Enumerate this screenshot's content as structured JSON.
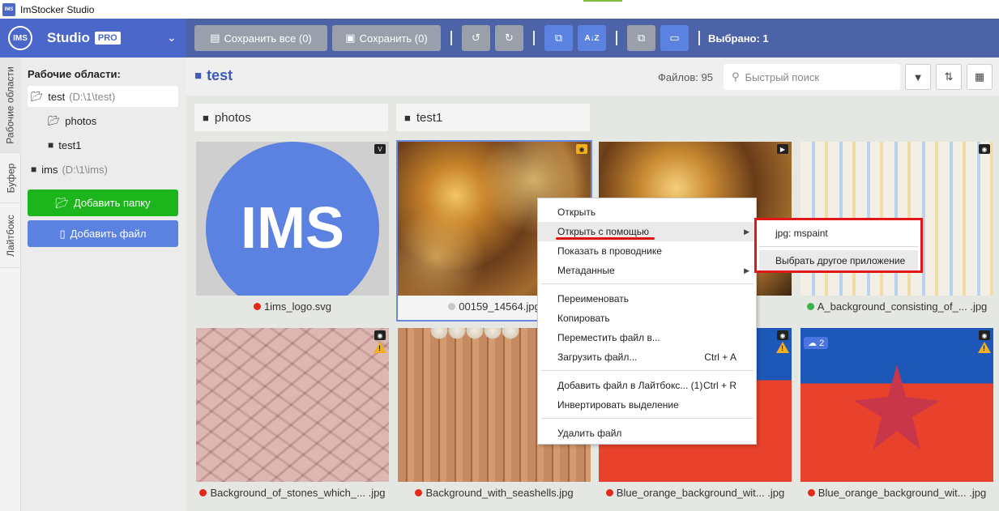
{
  "window": {
    "title": "ImStocker Studio"
  },
  "brand": {
    "logo": "IMS",
    "name": "Studio",
    "badge": "PRO"
  },
  "toolbar": {
    "save_all": "Сохранить все (0)",
    "save": "Сохранить (0)",
    "selected": "Выбрано: 1"
  },
  "vtabs": [
    "Рабочие области",
    "Буфер",
    "Лайтбокс"
  ],
  "sidebar": {
    "heading": "Рабочие области:",
    "tree": [
      {
        "label": "test",
        "path": "(D:\\1\\test)"
      },
      {
        "label": "photos"
      },
      {
        "label": "test1"
      },
      {
        "label": "ims",
        "path": "(D:\\1\\ims)"
      }
    ],
    "add_folder": "Добавить папку",
    "add_file": "Добавить файл"
  },
  "main": {
    "folder": "test",
    "files_count": "Файлов: 95",
    "search_placeholder": "Быстрый поиск",
    "subfolders": [
      "photos",
      "test1"
    ],
    "cards": [
      {
        "label": "1ims_logo.svg",
        "status": "#e02a1a",
        "logo_text": "IMS"
      },
      {
        "label": "00159_14564.jpg",
        "status": "#c8c8c8"
      },
      {
        "label": "",
        "status": ""
      },
      {
        "label": "A_background_consisting_of_... .jpg",
        "status": "#3bb54a"
      },
      {
        "label": "Background_of_stones_which_... .jpg",
        "status": "#e02a1a"
      },
      {
        "label": "Background_with_seashells.jpg",
        "status": "#e02a1a"
      },
      {
        "label": "Blue_orange_background_wit... .jpg",
        "status": "#e02a1a"
      },
      {
        "label": "Blue_orange_background_wit... .jpg",
        "status": "#e02a1a",
        "cloud": "2"
      }
    ]
  },
  "context_menu": {
    "items": [
      "Открыть",
      "Открыть с помощью",
      "Показать в проводнике",
      "Метаданные",
      "Переименовать",
      "Копировать",
      "Переместить файл в...",
      "Загрузить файл...",
      "Добавить файл в Лайтбокс... (1)",
      "Инвертировать выделение",
      "Удалить файл"
    ],
    "shortcuts": {
      "upload": "Ctrl + A",
      "lightbox": "Ctrl + R"
    }
  },
  "submenu": {
    "items": [
      "jpg: mspaint",
      "Выбрать другое приложение"
    ]
  },
  "colors": {
    "header": "#4a67c9",
    "toolbar": "#4d63a8",
    "add_folder": "#1cb51c",
    "add_file": "#5b82e0",
    "highlight": "#e01818"
  }
}
